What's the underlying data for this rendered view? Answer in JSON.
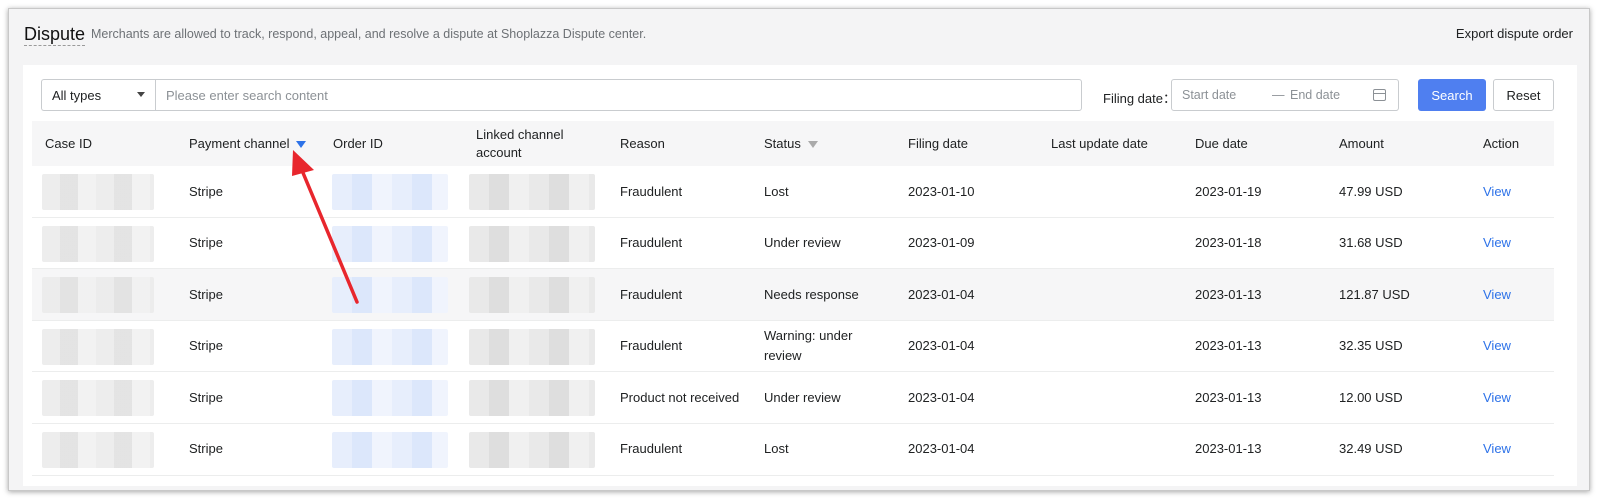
{
  "header": {
    "title": "Dispute",
    "subtitle": "Merchants are allowed to track, respond, appeal, and resolve a dispute at Shoplazza Dispute center.",
    "export_label": "Export dispute order"
  },
  "filters": {
    "type_value": "All types",
    "search_placeholder": "Please enter search content",
    "filing_date_label": "Filing date：",
    "start_placeholder": "Start date",
    "range_sep": "—",
    "end_placeholder": "End date",
    "search_label": "Search",
    "reset_label": "Reset"
  },
  "table": {
    "columns": {
      "case_id": "Case ID",
      "payment_channel": "Payment channel",
      "order_id": "Order ID",
      "linked_account": "Linked channel account",
      "reason": "Reason",
      "status": "Status",
      "filing_date": "Filing date",
      "last_update": "Last update date",
      "due_date": "Due date",
      "amount": "Amount",
      "action": "Action"
    },
    "rows": [
      {
        "channel": "Stripe",
        "reason": "Fraudulent",
        "status": "Lost",
        "filing": "2023-01-10",
        "last_update": "",
        "due": "2023-01-19",
        "amount": "47.99 USD",
        "action": "View"
      },
      {
        "channel": "Stripe",
        "reason": "Fraudulent",
        "status": "Under review",
        "filing": "2023-01-09",
        "last_update": "",
        "due": "2023-01-18",
        "amount": "31.68 USD",
        "action": "View"
      },
      {
        "channel": "Stripe",
        "reason": "Fraudulent",
        "status": "Needs response",
        "filing": "2023-01-04",
        "last_update": "",
        "due": "2023-01-13",
        "amount": "121.87 USD",
        "action": "View"
      },
      {
        "channel": "Stripe",
        "reason": "Fraudulent",
        "status": "Warning: under review",
        "filing": "2023-01-04",
        "last_update": "",
        "due": "2023-01-13",
        "amount": "32.35 USD",
        "action": "View"
      },
      {
        "channel": "Stripe",
        "reason": "Product not received",
        "status": "Under review",
        "filing": "2023-01-04",
        "last_update": "",
        "due": "2023-01-13",
        "amount": "12.00 USD",
        "action": "View"
      },
      {
        "channel": "Stripe",
        "reason": "Fraudulent",
        "status": "Lost",
        "filing": "2023-01-04",
        "last_update": "",
        "due": "2023-01-13",
        "amount": "32.49 USD",
        "action": "View"
      }
    ]
  },
  "colors": {
    "primary": "#4f7ff0",
    "link": "#2d72e8",
    "annotation_arrow": "#e8262d"
  },
  "icons": {
    "type_caret": "chevron-down-icon",
    "date_picker": "calendar-icon",
    "column_filter": "filter-icon",
    "annotation": "red-arrow"
  }
}
